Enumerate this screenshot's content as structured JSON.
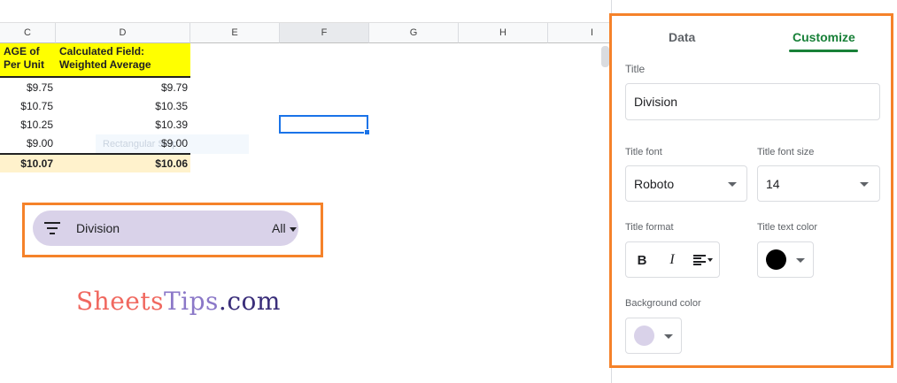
{
  "sheet": {
    "columns": [
      "C",
      "D",
      "E",
      "F",
      "G",
      "H",
      "I"
    ],
    "header_c": "AGE of\nPer Unit",
    "header_d": "Calculated Field:\nWeighted Average",
    "rows": [
      {
        "c": "$9.75",
        "d": "$9.79"
      },
      {
        "c": "$10.75",
        "d": "$10.35"
      },
      {
        "c": "$10.25",
        "d": "$10.39"
      },
      {
        "c": "$9.00",
        "d": "$9.00"
      }
    ],
    "total": {
      "c": "$10.07",
      "d": "$10.06"
    },
    "ghost_text": "Rectangular Snip",
    "colors": {
      "header_bg": "#ffff00",
      "total_bg": "#fff2cc",
      "selection": "#1a73e8"
    }
  },
  "filter_chip": {
    "label": "Division",
    "value": "All",
    "color": "#d9d2e9"
  },
  "watermark": {
    "part1": "Sheets",
    "part2": "Tips",
    "part3": ".com"
  },
  "editor": {
    "tabs": [
      {
        "label": "Data",
        "active": false
      },
      {
        "label": "Customize",
        "active": true
      }
    ],
    "title_label": "Title",
    "title_value": "Division",
    "title_font_label": "Title font",
    "title_font_value": "Roboto",
    "title_font_size_label": "Title font size",
    "title_font_size_value": "14",
    "title_format_label": "Title format",
    "format_bold": "B",
    "format_italic": "I",
    "title_text_color_label": "Title text color",
    "title_text_color": "#000000",
    "background_color_label": "Background color",
    "background_color": "#d9d2e9",
    "accent": "#188038",
    "highlight": "#f5822a"
  }
}
